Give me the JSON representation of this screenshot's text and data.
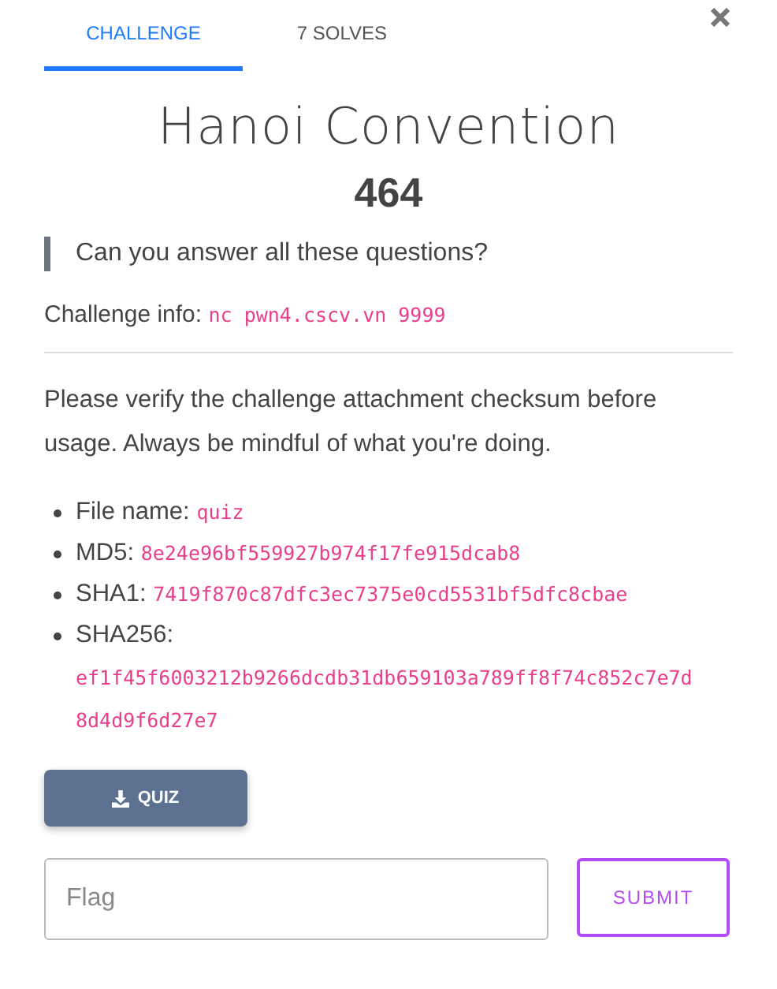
{
  "tabs": [
    {
      "label": "CHALLENGE",
      "selected": true
    },
    {
      "label": "7 SOLVES",
      "selected": false
    }
  ],
  "title": "Hanoi Convention",
  "points": "464",
  "quote": "Can you answer all these questions?",
  "info": {
    "label": "Challenge info:",
    "value": "nc pwn4.cscv.vn 9999"
  },
  "notice": "Please verify the challenge attachment checksum before usage. Always be mindful of what you're doing.",
  "file_details": [
    {
      "kind": "inline",
      "label": "File name:",
      "value": "quiz"
    },
    {
      "kind": "inline",
      "label": "MD5:",
      "value": "8e24e96bf559927b974f17fe915dcab8"
    },
    {
      "kind": "inline",
      "label": "SHA1:",
      "value": "7419f870c87dfc3ec7375e0cd5531bf5dfc8cbae"
    },
    {
      "kind": "block",
      "label": "SHA256:",
      "value": "ef1f45f6003212b9266dcdb31db659103a789ff8f74c852c7e7d8d4d9f6d27e7"
    }
  ],
  "download_button": "QUIZ",
  "flag_field": {
    "placeholder": "Flag"
  },
  "submit_button": "SUBMIT"
}
